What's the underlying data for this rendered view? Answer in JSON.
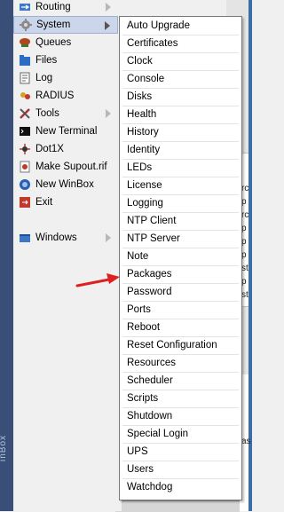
{
  "colors": {
    "strip": "#3a4f78",
    "active_bg": "#cbd6ea",
    "arrow_red": "#e02020",
    "submenu_bg": "#ffffff"
  },
  "side_strip": {
    "text": "inBox"
  },
  "main_menu": {
    "items": [
      {
        "label": "Routing",
        "icon": "routing-icon",
        "has_submenu": true
      },
      {
        "label": "System",
        "icon": "gear-icon",
        "has_submenu": true,
        "active": true
      },
      {
        "label": "Queues",
        "icon": "queues-icon",
        "has_submenu": false
      },
      {
        "label": "Files",
        "icon": "folder-icon",
        "has_submenu": false
      },
      {
        "label": "Log",
        "icon": "log-icon",
        "has_submenu": false
      },
      {
        "label": "RADIUS",
        "icon": "radius-icon",
        "has_submenu": false
      },
      {
        "label": "Tools",
        "icon": "tools-icon",
        "has_submenu": true
      },
      {
        "label": "New Terminal",
        "icon": "terminal-icon",
        "has_submenu": false
      },
      {
        "label": "Dot1X",
        "icon": "dot1x-icon",
        "has_submenu": false
      },
      {
        "label": "Make Supout.rif",
        "icon": "supout-icon",
        "has_submenu": false
      },
      {
        "label": "New WinBox",
        "icon": "winbox-icon",
        "has_submenu": false
      },
      {
        "label": "Exit",
        "icon": "exit-icon",
        "has_submenu": false
      },
      {
        "label": "Windows",
        "icon": "windows-icon",
        "has_submenu": true
      }
    ]
  },
  "system_submenu": {
    "items": [
      "Auto Upgrade",
      "Certificates",
      "Clock",
      "Console",
      "Disks",
      "Health",
      "History",
      "Identity",
      "LEDs",
      "License",
      "Logging",
      "NTP Client",
      "NTP Server",
      "Note",
      "Packages",
      "Password",
      "Ports",
      "Reboot",
      "Reset Configuration",
      "Resources",
      "Scheduler",
      "Scripts",
      "Shutdown",
      "Special Login",
      "UPS",
      "Users",
      "Watchdog"
    ],
    "highlighted": "Packages"
  },
  "background_window": {
    "fragments": [
      "rc",
      "p",
      "rc",
      "p",
      "p",
      "p",
      "st",
      "p",
      "st"
    ],
    "fragment_bottom": "as"
  }
}
